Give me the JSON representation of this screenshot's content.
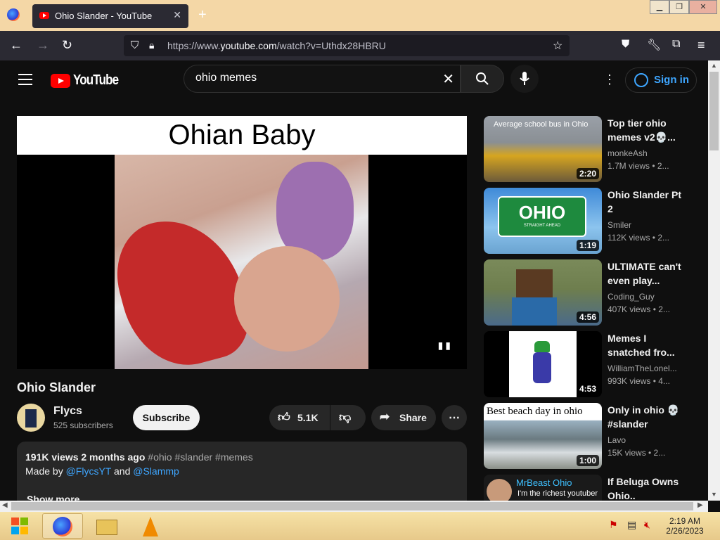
{
  "browser": {
    "tab_title": "Ohio Slander - YouTube",
    "url_prefix": "https://www.",
    "url_domain": "youtube.com",
    "url_path": "/watch?v=Uthdx28HBRU"
  },
  "youtube": {
    "logo_text": "YouTube",
    "search_value": "ohio memes",
    "sign_in": "Sign in",
    "accent_red": "#ff0000",
    "link_blue": "#3ea6ff"
  },
  "video": {
    "banner_text": "Ohian Baby",
    "title": "Ohio Slander",
    "channel": "Flycs",
    "subscribers": "525 subscribers",
    "subscribe_label": "Subscribe",
    "likes": "5.1K",
    "share_label": "Share",
    "views_age": "191K views  2 months ago",
    "hashtags": "#ohio #slander #memes",
    "made_by": "Made by",
    "handle_1": "@FlycsYT",
    "and_text": "and",
    "handle_2": "@Slammp",
    "show_more": "Show more"
  },
  "recommendations": [
    {
      "title": "Top tier ohio memes v2💀...",
      "channel": "monkeAsh",
      "views": "1.7M views  • 2...",
      "duration": "2:20",
      "thumb_caption": "Average school bus in Ohio"
    },
    {
      "title": "Ohio Slander Pt 2",
      "channel": "Smiler",
      "views": "112K views  • 2...",
      "duration": "1:19",
      "thumb_caption": "OHIO",
      "thumb_sub": "STRAIGHT AHEAD"
    },
    {
      "title": "ULTIMATE can't even play...",
      "channel": "Coding_Guy",
      "views": "407K views  • 2...",
      "duration": "4:56"
    },
    {
      "title": "Memes I snatched fro...",
      "channel": "WilliamTheLonel...",
      "views": "993K views  • 4...",
      "duration": "4:53"
    },
    {
      "title": "Only in ohio 💀 #slander",
      "channel": "Lavo",
      "views": "15K views  • 2...",
      "duration": "1:00",
      "thumb_caption": "Best beach day in ohio"
    },
    {
      "title": "If Beluga Owns Ohio..",
      "thumb_caption": "MrBeast Ohio",
      "thumb_sub": "I'm the richest youtuber"
    }
  ],
  "taskbar": {
    "time": "2:19 AM",
    "date": "2/26/2023"
  }
}
